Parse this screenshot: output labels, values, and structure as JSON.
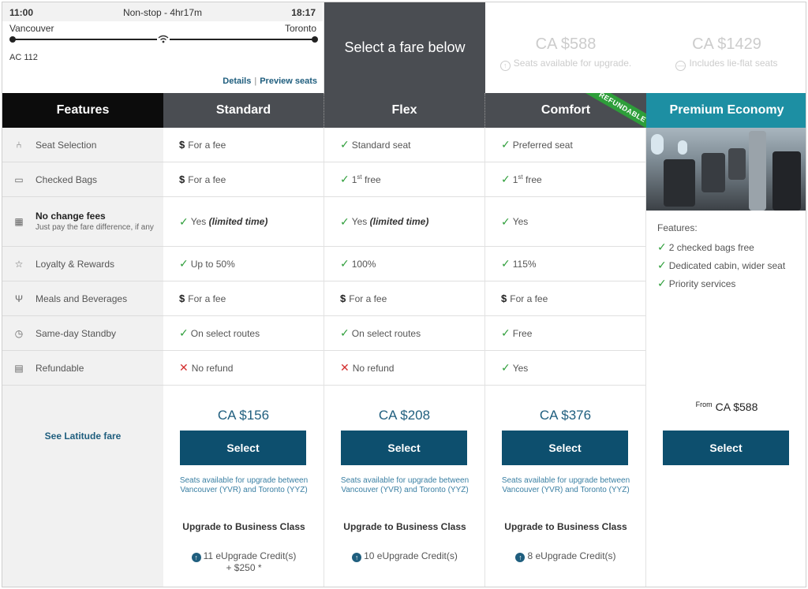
{
  "flight": {
    "depart_time": "11:00",
    "duration": "Non-stop - 4hr17m",
    "arrive_time": "18:17",
    "origin": "Vancouver",
    "destination": "Toronto",
    "flight_number": "AC 112",
    "details_link": "Details",
    "preview_link": "Preview seats",
    "separator": "|"
  },
  "prompt": "Select a fare below",
  "top_prices": [
    {
      "price": "CA $588",
      "note": "Seats available for upgrade.",
      "icon": "upgrade-circle-icon"
    },
    {
      "price": "CA $1429",
      "note": "Includes lie-flat seats",
      "icon": "lie-flat-icon"
    }
  ],
  "headers": {
    "features": "Features",
    "standard": "Standard",
    "flex": "Flex",
    "comfort": "Comfort",
    "comfort_ribbon": "REFUNDABLE",
    "premium": "Premium Economy"
  },
  "features": [
    {
      "label": "Seat Selection",
      "icon": "seat-icon"
    },
    {
      "label": "Checked Bags",
      "icon": "bag-icon"
    },
    {
      "label": "No change fees",
      "sub": "Just pay the fare difference, if any",
      "icon": "calendar-icon"
    },
    {
      "label": "Loyalty & Rewards",
      "icon": "star-icon"
    },
    {
      "label": "Meals and Beverages",
      "icon": "fork-icon"
    },
    {
      "label": "Same-day Standby",
      "icon": "clock-icon"
    },
    {
      "label": "Refundable",
      "icon": "receipt-icon"
    }
  ],
  "latitude_link": "See Latitude fare",
  "fares": {
    "standard": {
      "cells": [
        {
          "mark": "$",
          "text": "For a fee"
        },
        {
          "mark": "$",
          "text": "For a fee"
        },
        {
          "mark": "✓",
          "text": "Yes",
          "em": "(limited time)"
        },
        {
          "mark": "✓",
          "text": "Up to 50%"
        },
        {
          "mark": "$",
          "text": "For a fee"
        },
        {
          "mark": "✓",
          "text": "On select routes"
        },
        {
          "mark": "✕",
          "text": "No refund"
        }
      ],
      "price": "CA $156",
      "select": "Select",
      "upgrade_note": "Seats available for upgrade between Vancouver (YVR) and Toronto (YYZ)",
      "upgrade_title": "Upgrade to Business Class",
      "credits": "11 eUpgrade Credit(s)",
      "extra": "+ $250 *"
    },
    "flex": {
      "cells": [
        {
          "mark": "✓",
          "text": "Standard seat"
        },
        {
          "mark": "✓",
          "text": "1",
          "sup": "st",
          "after": " free"
        },
        {
          "mark": "✓",
          "text": "Yes",
          "em": "(limited time)"
        },
        {
          "mark": "✓",
          "text": "100%"
        },
        {
          "mark": "$",
          "text": "For a fee"
        },
        {
          "mark": "✓",
          "text": "On select routes"
        },
        {
          "mark": "✕",
          "text": "No refund"
        }
      ],
      "price": "CA $208",
      "select": "Select",
      "upgrade_note": "Seats available for upgrade between Vancouver (YVR) and Toronto (YYZ)",
      "upgrade_title": "Upgrade to Business Class",
      "credits": "10 eUpgrade Credit(s)",
      "extra": ""
    },
    "comfort": {
      "cells": [
        {
          "mark": "✓",
          "text": "Preferred seat"
        },
        {
          "mark": "✓",
          "text": "1",
          "sup": "st",
          "after": " free"
        },
        {
          "mark": "✓",
          "text": "Yes"
        },
        {
          "mark": "✓",
          "text": "115%"
        },
        {
          "mark": "$",
          "text": "For a fee"
        },
        {
          "mark": "✓",
          "text": "Free"
        },
        {
          "mark": "✓",
          "text": "Yes"
        }
      ],
      "price": "CA $376",
      "select": "Select",
      "upgrade_note": "Seats available for upgrade between Vancouver (YVR) and Toronto (YYZ)",
      "upgrade_title": "Upgrade to Business Class",
      "credits": "8 eUpgrade Credit(s)",
      "extra": ""
    }
  },
  "premium": {
    "features_label": "Features:",
    "items": [
      "2 checked bags free",
      "Dedicated cabin, wider seat",
      "Priority services"
    ],
    "from_label": "From",
    "price": "CA  $588",
    "select": "Select"
  },
  "colors": {
    "accent_teal": "#1d8fa3",
    "button_navy": "#0d4f6e",
    "header_dark": "#4a4d52",
    "check_green": "#2e9e3a",
    "cross_red": "#d32f2f"
  }
}
